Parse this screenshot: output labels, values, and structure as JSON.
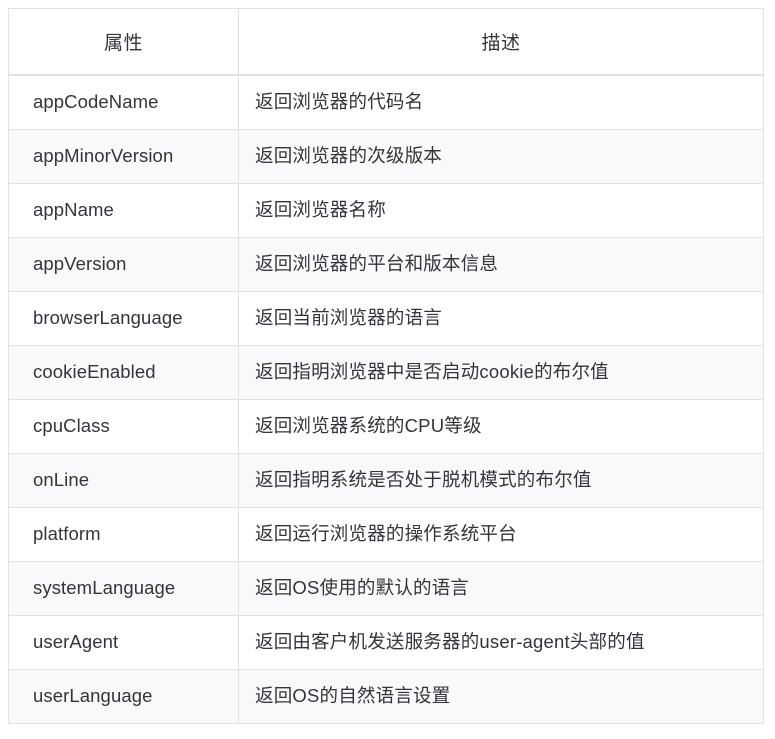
{
  "table": {
    "headers": {
      "attribute": "属性",
      "description": "描述"
    },
    "rows": [
      {
        "attribute": "appCodeName",
        "description": "返回浏览器的代码名"
      },
      {
        "attribute": "appMinorVersion",
        "description": "返回浏览器的次级版本"
      },
      {
        "attribute": "appName",
        "description": "返回浏览器名称"
      },
      {
        "attribute": "appVersion",
        "description": "返回浏览器的平台和版本信息"
      },
      {
        "attribute": "browserLanguage",
        "description": "返回当前浏览器的语言"
      },
      {
        "attribute": "cookieEnabled",
        "description": "返回指明浏览器中是否启动cookie的布尔值"
      },
      {
        "attribute": "cpuClass",
        "description": "返回浏览器系统的CPU等级"
      },
      {
        "attribute": "onLine",
        "description": "返回指明系统是否处于脱机模式的布尔值"
      },
      {
        "attribute": "platform",
        "description": "返回运行浏览器的操作系统平台"
      },
      {
        "attribute": "systemLanguage",
        "description": "返回OS使用的默认的语言"
      },
      {
        "attribute": "userAgent",
        "description": "返回由客户机发送服务器的user-agent头部的值"
      },
      {
        "attribute": "userLanguage",
        "description": "返回OS的自然语言设置"
      }
    ]
  },
  "colors": {
    "text": "#34343c",
    "border": "#e2e2e4",
    "row_alt_background": "#f9f9fa",
    "row_background": "#ffffff"
  }
}
